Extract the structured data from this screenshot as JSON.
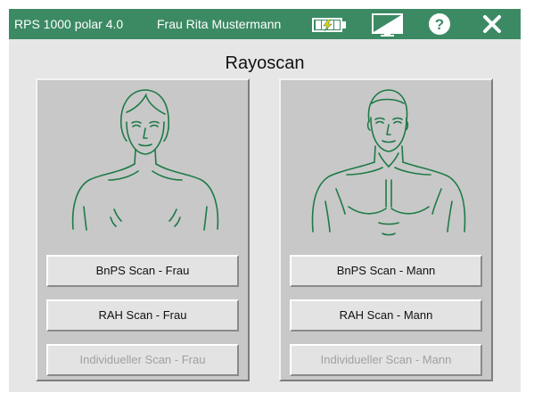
{
  "titlebar": {
    "app_title": "RPS 1000 polar 4.0",
    "user_name": "Frau Rita Mustermann",
    "icons": [
      "battery-icon",
      "display-icon",
      "help-icon",
      "close-icon"
    ]
  },
  "page": {
    "title": "Rayoscan"
  },
  "panels": [
    {
      "figure": "female-figure-icon",
      "buttons": [
        {
          "label": "BnPS Scan - Frau",
          "enabled": true
        },
        {
          "label": "RAH Scan - Frau",
          "enabled": true
        },
        {
          "label": "Individueller Scan - Frau",
          "enabled": false
        }
      ]
    },
    {
      "figure": "male-figure-icon",
      "buttons": [
        {
          "label": "BnPS Scan - Mann",
          "enabled": true
        },
        {
          "label": "RAH Scan - Mann",
          "enabled": true
        },
        {
          "label": "Individueller Scan - Mann",
          "enabled": false
        }
      ]
    }
  ],
  "colors": {
    "titlebar": "#3c8a64",
    "figure_line": "#1e7a46",
    "battery_fill": "#f0d000",
    "panel": "#c8c8c8",
    "button": "#e3e3e3",
    "disabled_text": "#a0a0a0"
  }
}
